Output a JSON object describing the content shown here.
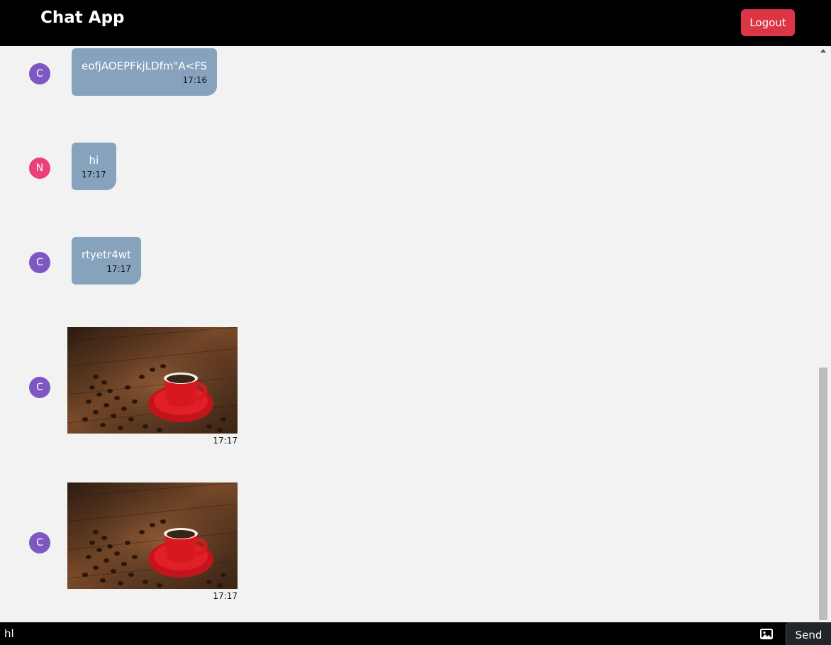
{
  "app": {
    "title": "Chat App",
    "logout_label": "Logout"
  },
  "messages": [
    {
      "avatar": "C",
      "text": "eofjAOEPFkjLDfm\"A<FS",
      "time": "17:16"
    },
    {
      "avatar": "N",
      "text": "hi",
      "time": "17:17"
    },
    {
      "avatar": "C",
      "text": "rtyetr4wt",
      "time": "17:17"
    },
    {
      "avatar": "C",
      "image": "coffee-cup-photo",
      "time": "17:17"
    },
    {
      "avatar": "C",
      "image": "coffee-cup-photo",
      "time": "17:17"
    }
  ],
  "composer": {
    "value": "hl",
    "send_label": "Send",
    "image_icon": "image-icon"
  },
  "colors": {
    "navbar": "#000000",
    "logout": "#dc3545",
    "bubble": "#87a2bd",
    "avatar_c": "#7e57c2",
    "avatar_n": "#ec407a"
  }
}
